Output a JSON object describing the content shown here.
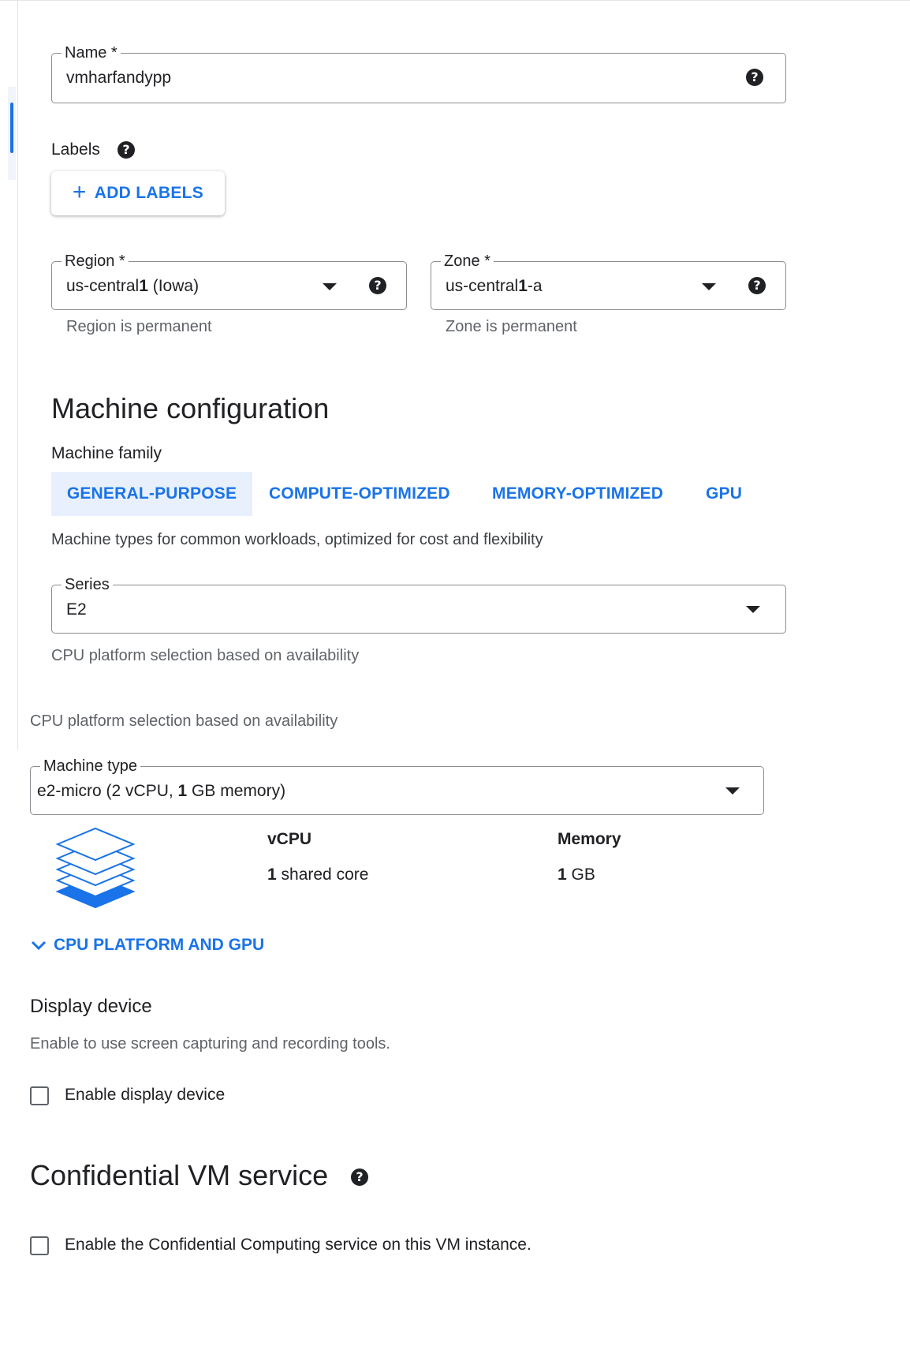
{
  "name_field": {
    "label": "Name *",
    "value": "vmharfandypp"
  },
  "labels": {
    "title": "Labels",
    "add_button": "ADD LABELS"
  },
  "region": {
    "label": "Region *",
    "value_prefix": "us-central",
    "value_bold": "1",
    "value_suffix": " (Iowa)",
    "hint": "Region is permanent"
  },
  "zone": {
    "label": "Zone *",
    "value_prefix": "us-central",
    "value_bold": "1",
    "value_suffix": "-a",
    "hint": "Zone is permanent"
  },
  "machine_config": {
    "title": "Machine configuration",
    "family_label": "Machine family",
    "tabs": [
      {
        "label": "GENERAL-PURPOSE",
        "active": true
      },
      {
        "label": "COMPUTE-OPTIMIZED",
        "active": false
      },
      {
        "label": "MEMORY-OPTIMIZED",
        "active": false
      },
      {
        "label": "GPU",
        "active": false
      }
    ],
    "family_description": "Machine types for common workloads, optimized for cost and flexibility",
    "series_label": "Series",
    "series_value": "E2",
    "cpu_platform_hint": "CPU platform selection based on availability",
    "cpu_platform_hint_repeat": "CPU platform selection based on availability",
    "machine_type_label": "Machine type",
    "machine_type_prefix": "e2-micro (2 vCPU, ",
    "machine_type_bold": "1",
    "machine_type_suffix": " GB memory)",
    "vcpu_label": "vCPU",
    "vcpu_value_bold": "1",
    "vcpu_value_rest": " shared core",
    "memory_label": "Memory",
    "memory_value_bold": "1",
    "memory_value_rest": " GB",
    "expand_link": "CPU PLATFORM AND GPU"
  },
  "display_device": {
    "title": "Display device",
    "description": "Enable to use screen capturing and recording tools.",
    "checkbox_label": "Enable display device",
    "checked": false
  },
  "confidential_vm": {
    "title": "Confidential VM service",
    "checkbox_label": "Enable the Confidential Computing service on this VM instance.",
    "checked": false
  },
  "colors": {
    "accent": "#1a73e8",
    "tab_active_bg": "#e8f0fe",
    "text": "#202124",
    "hint": "#5f6368",
    "border": "#8a8d91"
  },
  "icons": {
    "help": "help-circle-icon",
    "dropdown": "caret-down-icon",
    "add": "plus-icon",
    "expand": "chevron-down-icon",
    "machine": "layers-stack-icon"
  }
}
